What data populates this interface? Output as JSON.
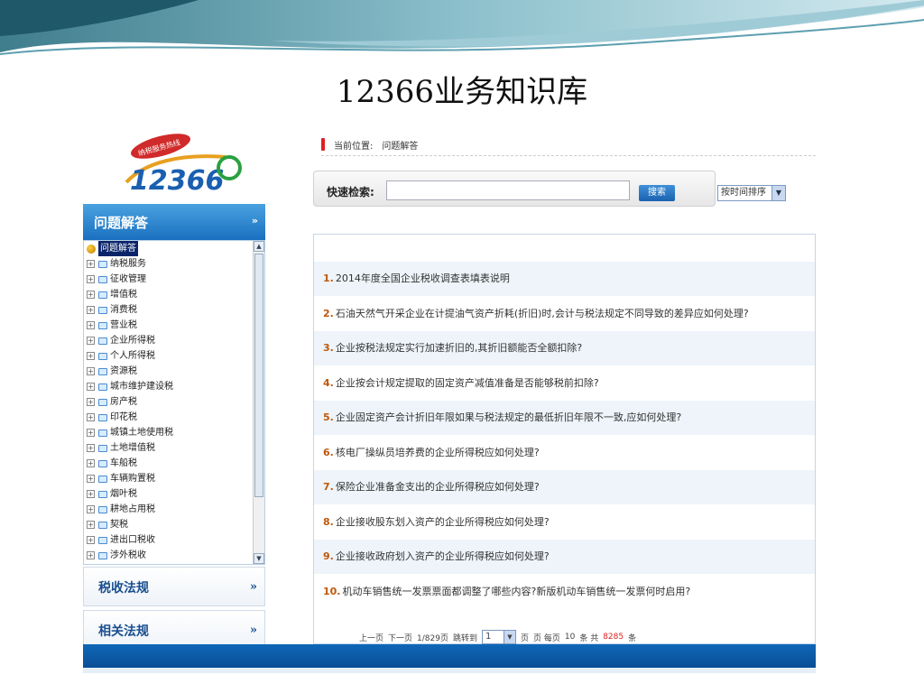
{
  "slide_title": "12366业务知识库",
  "logo": {
    "badge_text": "纳税服务热线",
    "number_text": "12366"
  },
  "sidebar": {
    "header_label": "问题解答",
    "header_icon": "chevron-double-down-icon",
    "tree_root": "问题解答",
    "tree_items": [
      "纳税服务",
      "征收管理",
      "增值税",
      "消费税",
      "营业税",
      "企业所得税",
      "个人所得税",
      "资源税",
      "城市维护建设税",
      "房产税",
      "印花税",
      "城镇土地使用税",
      "土地增值税",
      "车船税",
      "车辆购置税",
      "烟叶税",
      "耕地占用税",
      "契税",
      "进出口税收",
      "涉外税收"
    ],
    "sections": [
      {
        "label": "税收法规",
        "arrow": "»"
      },
      {
        "label": "相关法规",
        "arrow": "»"
      }
    ]
  },
  "breadcrumb": {
    "label": "当前位置:",
    "current": "问题解答"
  },
  "search": {
    "label": "快速检索:",
    "value": "",
    "button": "搜索",
    "sort_selected": "按时间排序"
  },
  "results": [
    {
      "num": "1.",
      "text": "2014年度全国企业税收调查表填表说明"
    },
    {
      "num": "2.",
      "text": "石油天然气开采企业在计提油气资产折耗(折旧)时,会计与税法规定不同导致的差异应如何处理?"
    },
    {
      "num": "3.",
      "text": "企业按税法规定实行加速折旧的,其折旧额能否全额扣除?"
    },
    {
      "num": "4.",
      "text": "企业按会计规定提取的固定资产减值准备是否能够税前扣除?"
    },
    {
      "num": "5.",
      "text": "企业固定资产会计折旧年限如果与税法规定的最低折旧年限不一致,应如何处理?"
    },
    {
      "num": "6.",
      "text": "核电厂操纵员培养费的企业所得税应如何处理?"
    },
    {
      "num": "7.",
      "text": "保险企业准备金支出的企业所得税应如何处理?"
    },
    {
      "num": "8.",
      "text": "企业接收股东划入资产的企业所得税应如何处理?"
    },
    {
      "num": "9.",
      "text": "企业接收政府划入资产的企业所得税应如何处理?"
    },
    {
      "num": "10.",
      "text": "机动车销售统一发票票面都调整了哪些内容?新版机动车销售统一发票何时启用?"
    }
  ],
  "pager": {
    "prev": "上一页",
    "next": "下一页",
    "page_info": "1/829页",
    "jump_label": "跳转到",
    "page_value": "1",
    "page_suffix": "页",
    "per_page_label": "页 每页",
    "per_page": "10",
    "total_prefix": "条 共",
    "total": "8285",
    "total_suffix": "条"
  },
  "colors": {
    "accent": "#1a70c0",
    "result_number": "#c0580a",
    "total": "#e02020",
    "bottom_bar": "#0a4e95"
  }
}
